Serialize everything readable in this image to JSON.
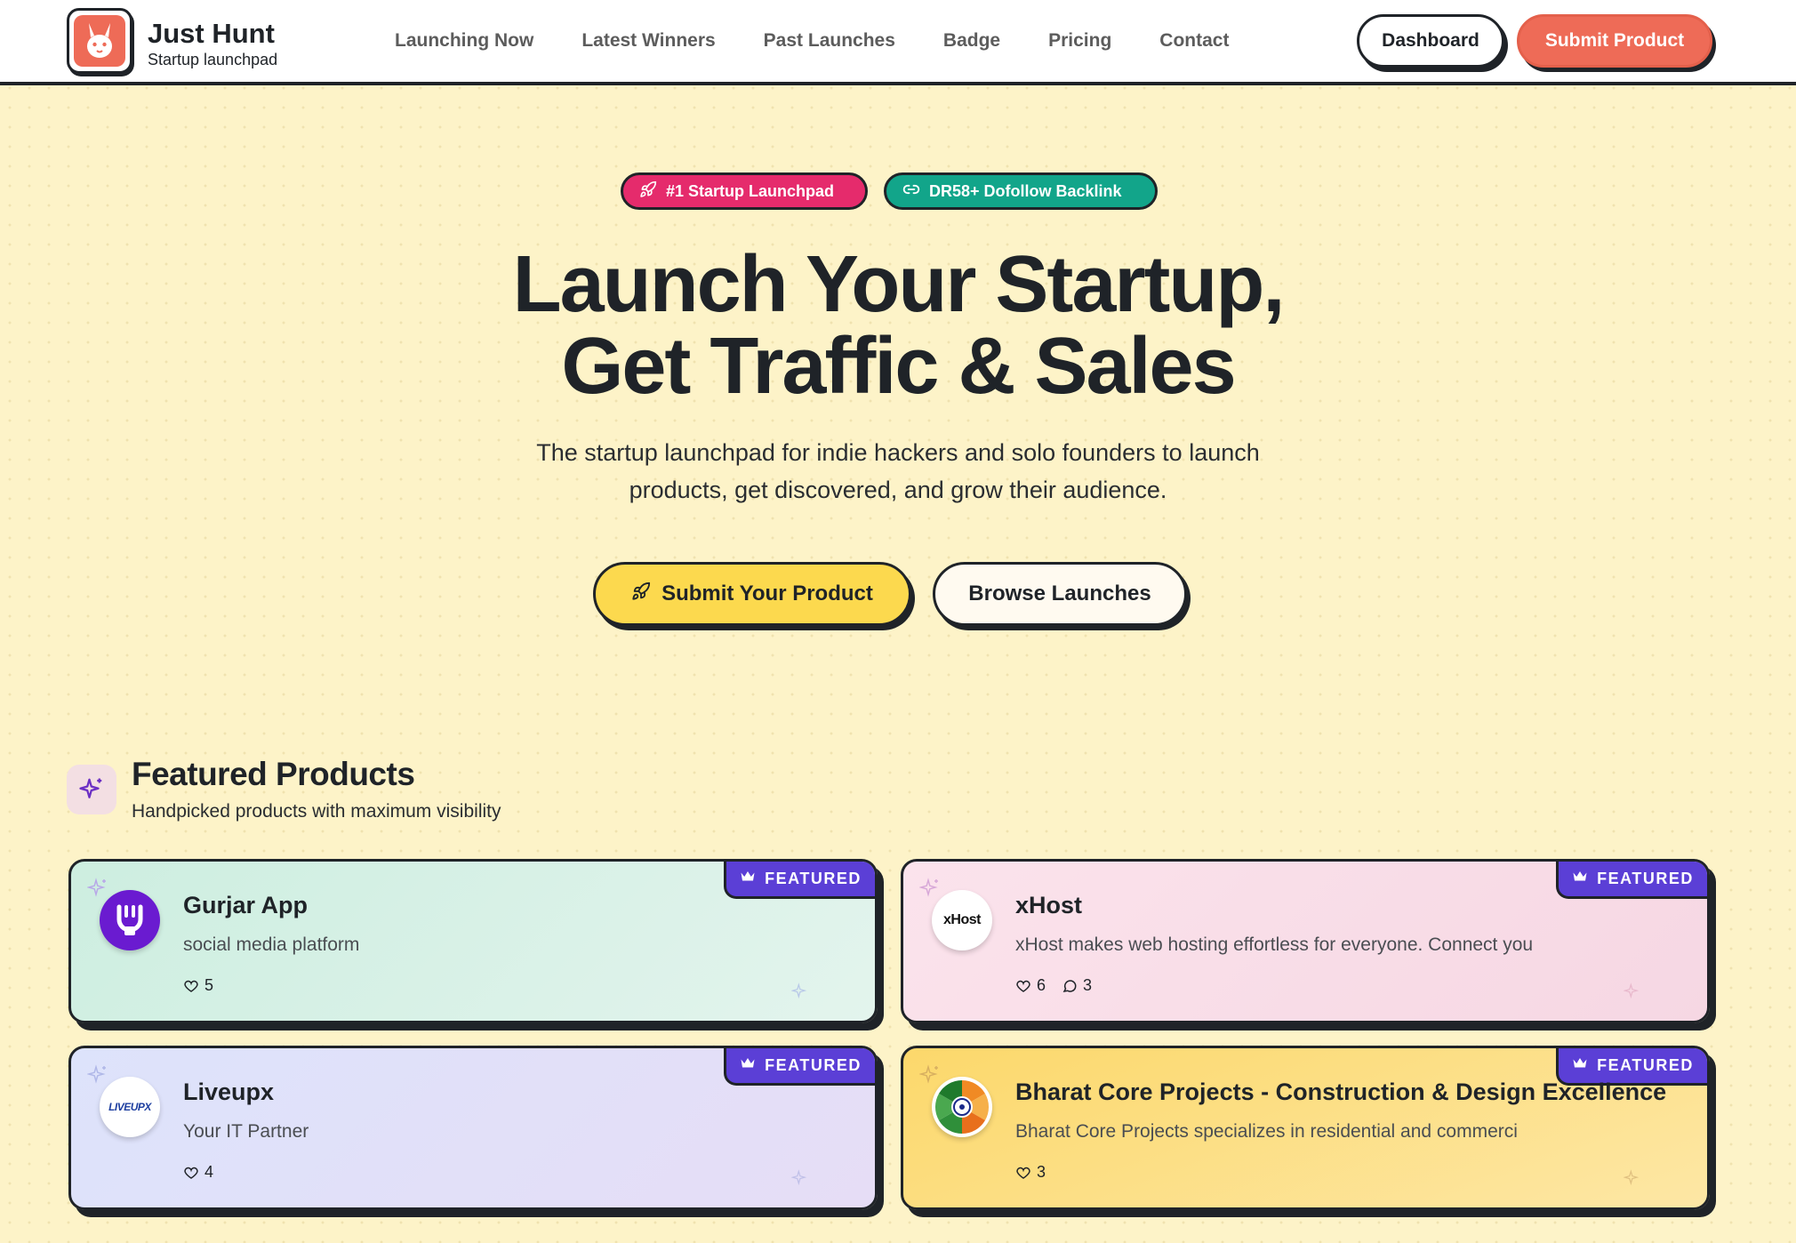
{
  "brand": {
    "name": "Just Hunt",
    "tagline": "Startup launchpad",
    "logo_icon": "rabbit-icon",
    "accent": "#ee6b57"
  },
  "nav": {
    "links": [
      "Launching Now",
      "Latest Winners",
      "Past Launches",
      "Badge",
      "Pricing",
      "Contact"
    ],
    "dashboard_label": "Dashboard",
    "submit_label": "Submit Product"
  },
  "hero": {
    "badges": [
      {
        "label": "#1 Startup Launchpad",
        "icon": "rocket-icon",
        "color": "#e52b6c"
      },
      {
        "label": "DR58+ Dofollow Backlink",
        "icon": "link-icon",
        "color": "#12a58a"
      }
    ],
    "title_line1": "Launch Your Startup,",
    "title_line2": "Get Traffic & Sales",
    "subtitle_line1": "The startup launchpad for indie hackers and solo founders to launch",
    "subtitle_line2": "products, get discovered, and grow their audience.",
    "primary_cta": "Submit Your Product",
    "secondary_cta": "Browse Launches"
  },
  "featured": {
    "title": "Featured Products",
    "subtitle": "Handpicked products with maximum visibility",
    "tag_label": "FEATURED",
    "products": [
      {
        "name": "Gurjar App",
        "description": "social media platform",
        "likes": "5",
        "logo": "gurjar-app-logo"
      },
      {
        "name": "xHost",
        "description": "xHost makes web hosting effortless for everyone. Connect you",
        "likes": "6",
        "comments": "3",
        "logo_text": "xHost"
      },
      {
        "name": "Liveupx",
        "description": "Your IT Partner",
        "likes": "4",
        "logo_text": "LIVEUPX"
      },
      {
        "name": "Bharat Core Projects - Construction & Design Excellence",
        "description": "Bharat Core Projects specializes in residential and commerci",
        "likes": "3",
        "logo": "bharat-core-logo"
      }
    ]
  }
}
